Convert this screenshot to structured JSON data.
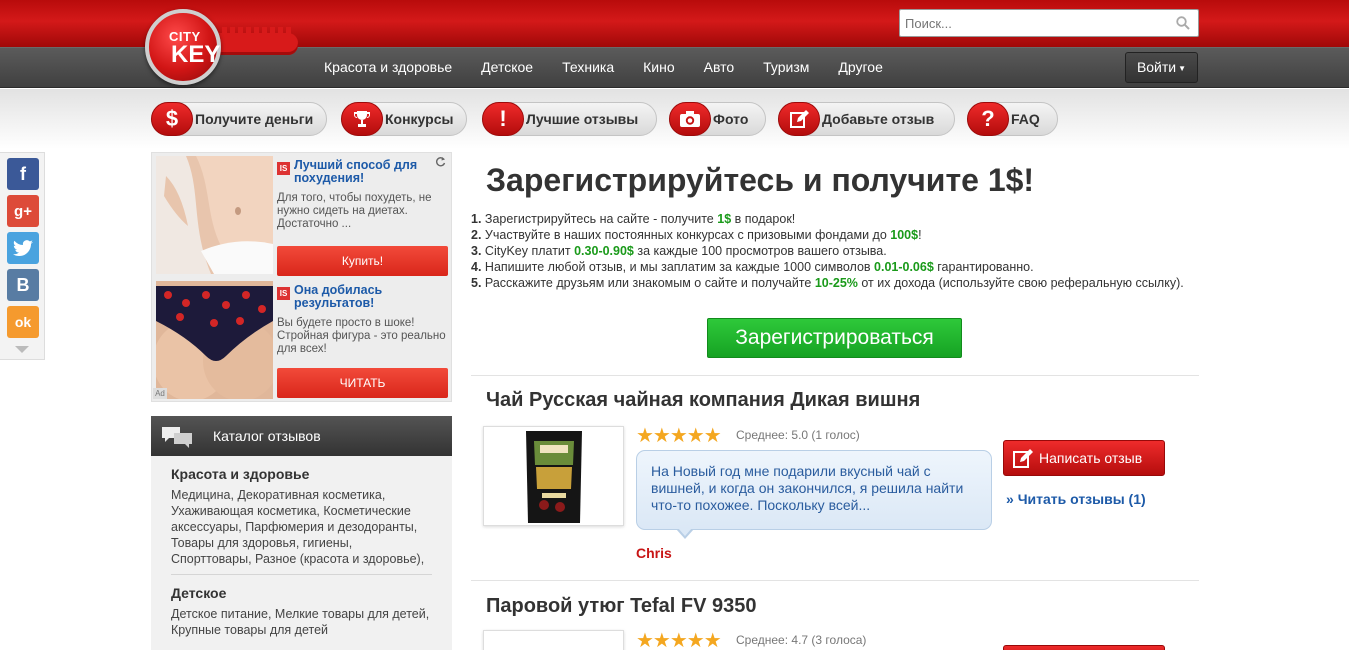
{
  "header": {
    "logo_city": "CITY",
    "logo_key": "KEY",
    "search": {
      "placeholder": "Поиск..."
    },
    "nav": [
      "Красота и здоровье",
      "Детское",
      "Техника",
      "Кино",
      "Авто",
      "Туризм",
      "Другое"
    ],
    "login_label": "Войти"
  },
  "subnav": [
    {
      "icon": "dollar-icon",
      "glyph": "$",
      "label": "Получите деньги"
    },
    {
      "icon": "trophy-icon",
      "glyph": "🏆",
      "label": "Конкурсы"
    },
    {
      "icon": "exclamation-icon",
      "glyph": "!",
      "label": "Лучшие отзывы"
    },
    {
      "icon": "camera-icon",
      "glyph": "📷",
      "label": "Фото"
    },
    {
      "icon": "pen-icon",
      "glyph": "✎",
      "label": "Добавьте отзыв"
    },
    {
      "icon": "question-icon",
      "glyph": "?",
      "label": "FAQ"
    }
  ],
  "social": [
    {
      "icon": "facebook-icon",
      "glyph": "f",
      "color": "#3b5998"
    },
    {
      "icon": "google-plus-icon",
      "glyph": "g+",
      "color": "#dd4b39"
    },
    {
      "icon": "twitter-icon",
      "glyph": "🐦",
      "color": "#4aa3df"
    },
    {
      "icon": "vk-icon",
      "glyph": "B",
      "color": "#587ca3"
    },
    {
      "icon": "odnoklassniki-icon",
      "glyph": "ok",
      "color": "#f59a2e"
    }
  ],
  "ads": [
    {
      "title": "Лучший способ для похудения!",
      "desc": "Для того, чтобы похудеть, не нужно сидеть на диетах. Достаточно ...",
      "button": "Купить!"
    },
    {
      "title": "Она добилась результатов!",
      "desc": "Вы будете просто в шоке! Стройная фигура - это реально для всех!",
      "button": "ЧИТАТЬ"
    }
  ],
  "ad_badge": "IS",
  "ad_choice": "Ad",
  "catalog": {
    "title": "Каталог отзывов",
    "sections": [
      {
        "title": "Красота и здоровье",
        "items": "Медицина, Декоративная косметика, Ухаживающая косметика, Косметические аксессуары, Парфюмерия и дезодоранты, Товары для здоровья, гигиены, Спорттовары, Разное (красота и здоровье),"
      },
      {
        "title": "Детское",
        "items": "Детское питание, Мелкие товары для детей, Крупные товары для детей"
      }
    ]
  },
  "main": {
    "title": "Зарегистрируйтесь и получите 1$!",
    "steps": [
      {
        "num": "1.",
        "pre": " Зарегистрируйтесь на сайте - получите ",
        "hl": "1$",
        "post": " в подарок!"
      },
      {
        "num": "2.",
        "pre": " Участвуйте в наших постоянных конкурсах с призовыми фондами до ",
        "hl": "100$",
        "post": "!"
      },
      {
        "num": "3.",
        "pre": " CityKey платит ",
        "hl": "0.30-0.90$",
        "post": " за каждые 100 просмотров вашего отзыва."
      },
      {
        "num": "4.",
        "pre": " Напишите любой отзыв, и мы заплатим за каждые 1000 символов ",
        "hl": "0.01-0.06$",
        "post": " гарантированно."
      },
      {
        "num": "5.",
        "pre": " Расскажите друзьям или знакомым о сайте и получайте ",
        "hl": "10-25%",
        "post": " от их дохода (используйте свою реферальную ссылку)."
      }
    ],
    "register_label": "Зарегистрироваться"
  },
  "reviews": [
    {
      "title": "Чай Русская чайная компания Дикая вишня",
      "stars": "★★★★★",
      "rating_text": "Среднее: 5.0 (1 голос)",
      "rating": 5.0,
      "excerpt": "На Новый год мне подарили вкусный чай с вишней, и когда он закончился, я решила найти что-то похожее. Поскольку всей...",
      "author": "Chris",
      "write_label": "Написать отзыв",
      "read_label": "Читать отзывы (1)"
    },
    {
      "title": "Паровой утюг Tefal FV 9350",
      "stars": "★★★★★",
      "rating_text": "Среднее: 4.7 (3 голоса)",
      "rating": 4.7
    }
  ]
}
